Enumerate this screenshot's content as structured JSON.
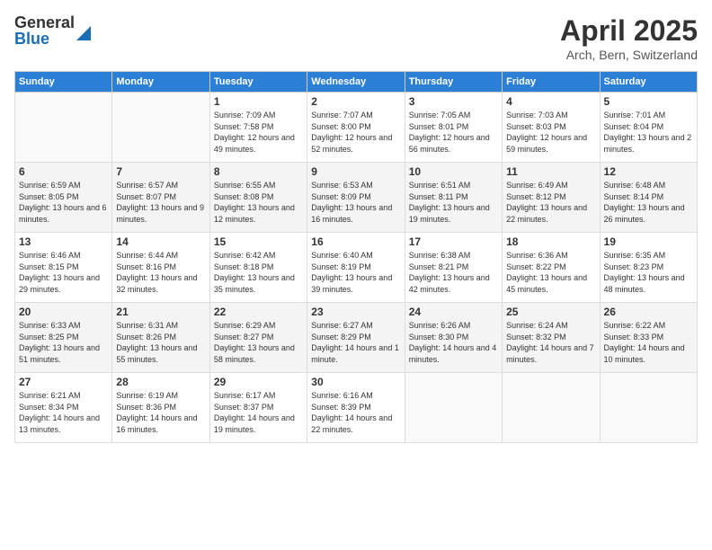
{
  "logo": {
    "general": "General",
    "blue": "Blue"
  },
  "title": {
    "month": "April 2025",
    "location": "Arch, Bern, Switzerland"
  },
  "headers": [
    "Sunday",
    "Monday",
    "Tuesday",
    "Wednesday",
    "Thursday",
    "Friday",
    "Saturday"
  ],
  "weeks": [
    [
      {
        "day": "",
        "info": ""
      },
      {
        "day": "",
        "info": ""
      },
      {
        "day": "1",
        "info": "Sunrise: 7:09 AM\nSunset: 7:58 PM\nDaylight: 12 hours and 49 minutes."
      },
      {
        "day": "2",
        "info": "Sunrise: 7:07 AM\nSunset: 8:00 PM\nDaylight: 12 hours and 52 minutes."
      },
      {
        "day": "3",
        "info": "Sunrise: 7:05 AM\nSunset: 8:01 PM\nDaylight: 12 hours and 56 minutes."
      },
      {
        "day": "4",
        "info": "Sunrise: 7:03 AM\nSunset: 8:03 PM\nDaylight: 12 hours and 59 minutes."
      },
      {
        "day": "5",
        "info": "Sunrise: 7:01 AM\nSunset: 8:04 PM\nDaylight: 13 hours and 2 minutes."
      }
    ],
    [
      {
        "day": "6",
        "info": "Sunrise: 6:59 AM\nSunset: 8:05 PM\nDaylight: 13 hours and 6 minutes."
      },
      {
        "day": "7",
        "info": "Sunrise: 6:57 AM\nSunset: 8:07 PM\nDaylight: 13 hours and 9 minutes."
      },
      {
        "day": "8",
        "info": "Sunrise: 6:55 AM\nSunset: 8:08 PM\nDaylight: 13 hours and 12 minutes."
      },
      {
        "day": "9",
        "info": "Sunrise: 6:53 AM\nSunset: 8:09 PM\nDaylight: 13 hours and 16 minutes."
      },
      {
        "day": "10",
        "info": "Sunrise: 6:51 AM\nSunset: 8:11 PM\nDaylight: 13 hours and 19 minutes."
      },
      {
        "day": "11",
        "info": "Sunrise: 6:49 AM\nSunset: 8:12 PM\nDaylight: 13 hours and 22 minutes."
      },
      {
        "day": "12",
        "info": "Sunrise: 6:48 AM\nSunset: 8:14 PM\nDaylight: 13 hours and 26 minutes."
      }
    ],
    [
      {
        "day": "13",
        "info": "Sunrise: 6:46 AM\nSunset: 8:15 PM\nDaylight: 13 hours and 29 minutes."
      },
      {
        "day": "14",
        "info": "Sunrise: 6:44 AM\nSunset: 8:16 PM\nDaylight: 13 hours and 32 minutes."
      },
      {
        "day": "15",
        "info": "Sunrise: 6:42 AM\nSunset: 8:18 PM\nDaylight: 13 hours and 35 minutes."
      },
      {
        "day": "16",
        "info": "Sunrise: 6:40 AM\nSunset: 8:19 PM\nDaylight: 13 hours and 39 minutes."
      },
      {
        "day": "17",
        "info": "Sunrise: 6:38 AM\nSunset: 8:21 PM\nDaylight: 13 hours and 42 minutes."
      },
      {
        "day": "18",
        "info": "Sunrise: 6:36 AM\nSunset: 8:22 PM\nDaylight: 13 hours and 45 minutes."
      },
      {
        "day": "19",
        "info": "Sunrise: 6:35 AM\nSunset: 8:23 PM\nDaylight: 13 hours and 48 minutes."
      }
    ],
    [
      {
        "day": "20",
        "info": "Sunrise: 6:33 AM\nSunset: 8:25 PM\nDaylight: 13 hours and 51 minutes."
      },
      {
        "day": "21",
        "info": "Sunrise: 6:31 AM\nSunset: 8:26 PM\nDaylight: 13 hours and 55 minutes."
      },
      {
        "day": "22",
        "info": "Sunrise: 6:29 AM\nSunset: 8:27 PM\nDaylight: 13 hours and 58 minutes."
      },
      {
        "day": "23",
        "info": "Sunrise: 6:27 AM\nSunset: 8:29 PM\nDaylight: 14 hours and 1 minute."
      },
      {
        "day": "24",
        "info": "Sunrise: 6:26 AM\nSunset: 8:30 PM\nDaylight: 14 hours and 4 minutes."
      },
      {
        "day": "25",
        "info": "Sunrise: 6:24 AM\nSunset: 8:32 PM\nDaylight: 14 hours and 7 minutes."
      },
      {
        "day": "26",
        "info": "Sunrise: 6:22 AM\nSunset: 8:33 PM\nDaylight: 14 hours and 10 minutes."
      }
    ],
    [
      {
        "day": "27",
        "info": "Sunrise: 6:21 AM\nSunset: 8:34 PM\nDaylight: 14 hours and 13 minutes."
      },
      {
        "day": "28",
        "info": "Sunrise: 6:19 AM\nSunset: 8:36 PM\nDaylight: 14 hours and 16 minutes."
      },
      {
        "day": "29",
        "info": "Sunrise: 6:17 AM\nSunset: 8:37 PM\nDaylight: 14 hours and 19 minutes."
      },
      {
        "day": "30",
        "info": "Sunrise: 6:16 AM\nSunset: 8:39 PM\nDaylight: 14 hours and 22 minutes."
      },
      {
        "day": "",
        "info": ""
      },
      {
        "day": "",
        "info": ""
      },
      {
        "day": "",
        "info": ""
      }
    ]
  ]
}
